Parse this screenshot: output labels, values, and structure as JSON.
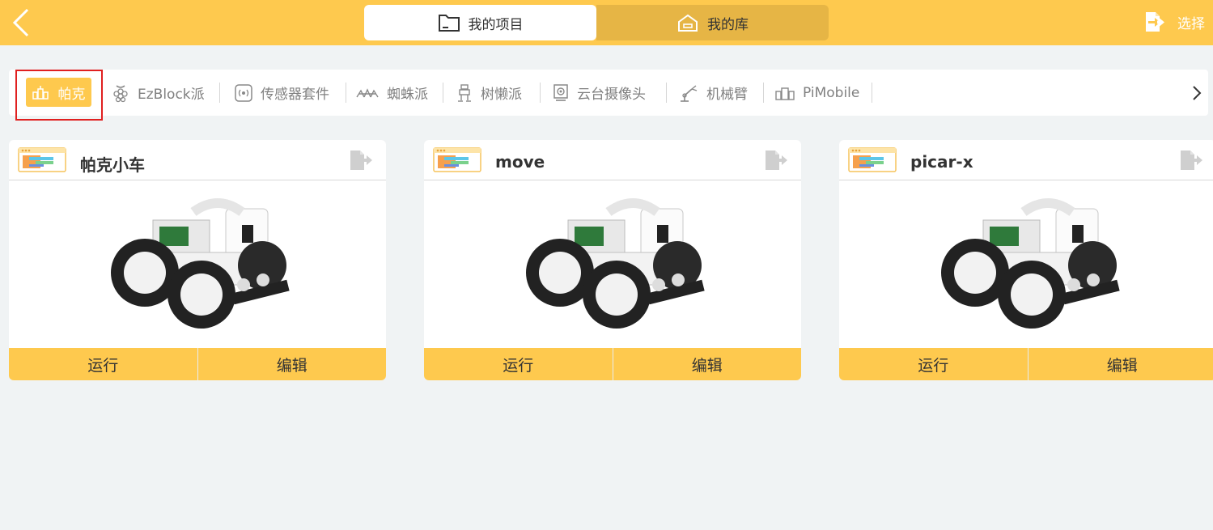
{
  "header": {
    "tabs": [
      {
        "label": "我的项目",
        "icon": "folder-icon"
      },
      {
        "label": "我的库",
        "icon": "home-icon"
      }
    ],
    "select_label": "选择"
  },
  "categories": {
    "active": {
      "label": "帕克",
      "icon": "pico-bot-icon"
    },
    "items": [
      {
        "label": "EzBlock派",
        "icon": "raspberry-icon"
      },
      {
        "label": "传感器套件",
        "icon": "sensor-icon"
      },
      {
        "label": "蜘蛛派",
        "icon": "spider-icon"
      },
      {
        "label": "树懒派",
        "icon": "sloth-icon"
      },
      {
        "label": "云台摄像头",
        "icon": "camera-icon"
      },
      {
        "label": "机械臂",
        "icon": "robot-arm-icon"
      },
      {
        "label": "PiMobile",
        "icon": "pimobile-icon"
      }
    ]
  },
  "projects": [
    {
      "title": "帕克小车",
      "run_label": "运行",
      "edit_label": "编辑"
    },
    {
      "title": "move",
      "run_label": "运行",
      "edit_label": "编辑"
    },
    {
      "title": "picar-x",
      "run_label": "运行",
      "edit_label": "编辑"
    }
  ],
  "colors": {
    "accent": "#fec94e",
    "accent_dark": "#e6b545",
    "background": "#f0f3f4",
    "highlight_frame": "#e02020"
  }
}
